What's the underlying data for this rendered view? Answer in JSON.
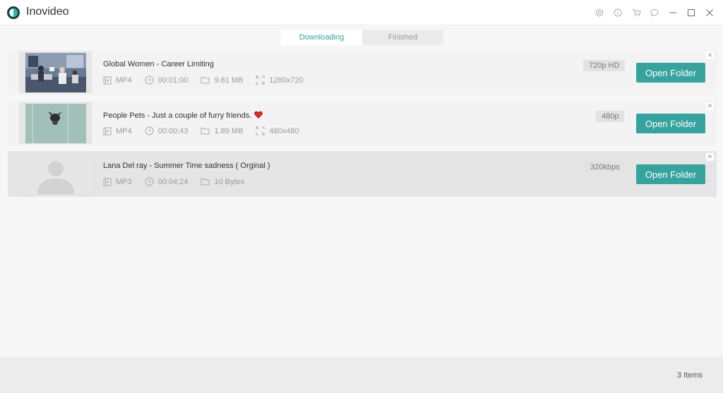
{
  "app": {
    "title": "Inovideo"
  },
  "window_icons": [
    "settings-icon",
    "info-icon",
    "cart-icon",
    "feedback-icon",
    "minimize-icon",
    "maximize-icon",
    "close-icon"
  ],
  "tabs": [
    {
      "label": "Downloading",
      "active": true
    },
    {
      "label": "Finished",
      "active": false
    }
  ],
  "items": [
    {
      "title": "Global Women - Career Limiting",
      "has_heart": false,
      "format": "MP4",
      "duration": "00:01:00",
      "size": "9.61 MB",
      "resolution": "1280x720",
      "quality": "720p HD",
      "open_label": "Open Folder",
      "thumbnail": "office-scene"
    },
    {
      "title": "People Pets - Just a couple of furry friends.",
      "has_heart": true,
      "format": "MP4",
      "duration": "00:00:43",
      "size": "1.89 MB",
      "resolution": "480x480",
      "quality": "480p",
      "open_label": "Open Folder",
      "thumbnail": "pet-scene"
    },
    {
      "title": "Lana Del ray - Summer Time sadness ( Orginal )",
      "has_heart": false,
      "format": "MP3",
      "duration": "00:04:24",
      "size": "10 Bytes",
      "resolution": "",
      "quality": "320kbps",
      "open_label": "Open Folder",
      "thumbnail": "person-placeholder"
    }
  ],
  "footer": {
    "count": "3 Items"
  },
  "colors": {
    "accent": "#37a39e",
    "tab_active_text": "#2aa6a2"
  }
}
